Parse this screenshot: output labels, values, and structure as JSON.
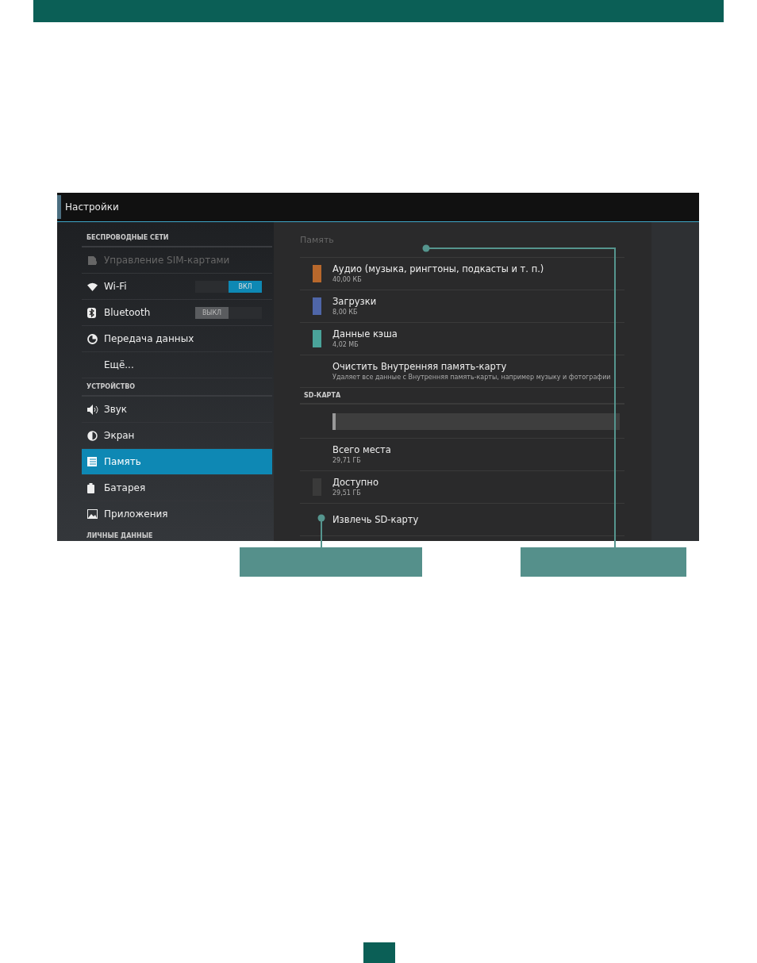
{
  "action_bar": {
    "title": "Настройки"
  },
  "sidebar": {
    "sections": [
      {
        "header": "БЕСПРОВОДНЫЕ СЕТИ",
        "items": [
          {
            "label": "Управление SIM-картами",
            "disabled": true,
            "selected": false
          },
          {
            "label": "Wi-Fi",
            "disabled": false,
            "selected": false,
            "toggle": {
              "text": "ВКЛ",
              "on": true
            }
          },
          {
            "label": "Bluetooth",
            "disabled": false,
            "selected": false,
            "toggle": {
              "text": "ВЫКЛ",
              "on": false
            }
          },
          {
            "label": "Передача данных",
            "disabled": false,
            "selected": false
          },
          {
            "label": "Ещё...",
            "disabled": false,
            "selected": false
          }
        ]
      },
      {
        "header": "УСТРОЙСТВО",
        "items": [
          {
            "label": "Звук",
            "disabled": false,
            "selected": false
          },
          {
            "label": "Экран",
            "disabled": false,
            "selected": false
          },
          {
            "label": "Память",
            "disabled": false,
            "selected": true
          },
          {
            "label": "Батарея",
            "disabled": false,
            "selected": false
          },
          {
            "label": "Приложения",
            "disabled": false,
            "selected": false
          }
        ]
      },
      {
        "header": "ЛИЧНЫЕ ДАННЫЕ"
      }
    ]
  },
  "content": {
    "title": "Память",
    "rows": [
      {
        "kind": "swatch",
        "color": "#b8682c",
        "title": "Аудио (музыка, рингтоны, подкасты и т. п.)",
        "subtitle": "40,00 КБ"
      },
      {
        "kind": "swatch",
        "color": "#4f66a8",
        "title": "Загрузки",
        "subtitle": "8,00 КБ"
      },
      {
        "kind": "swatch",
        "color": "#4aa39a",
        "title": "Данные кэша",
        "subtitle": "4,02 МБ"
      },
      {
        "kind": "text",
        "title": "Очистить Внутренняя память-карту",
        "subtitle": "Удаляет все данные с Внутренняя память-карты, например музыку и фотографии"
      },
      {
        "kind": "header",
        "title": "SD-КАРТА"
      },
      {
        "kind": "bar",
        "level": 0.01
      },
      {
        "kind": "text",
        "title": "Всего места",
        "subtitle": "29,71 ГБ"
      },
      {
        "kind": "swatch",
        "color": "#3a3a3a",
        "title": "Доступно",
        "subtitle": "29,51 ГБ"
      },
      {
        "kind": "text",
        "title": "Извлечь SD-карту"
      }
    ]
  }
}
